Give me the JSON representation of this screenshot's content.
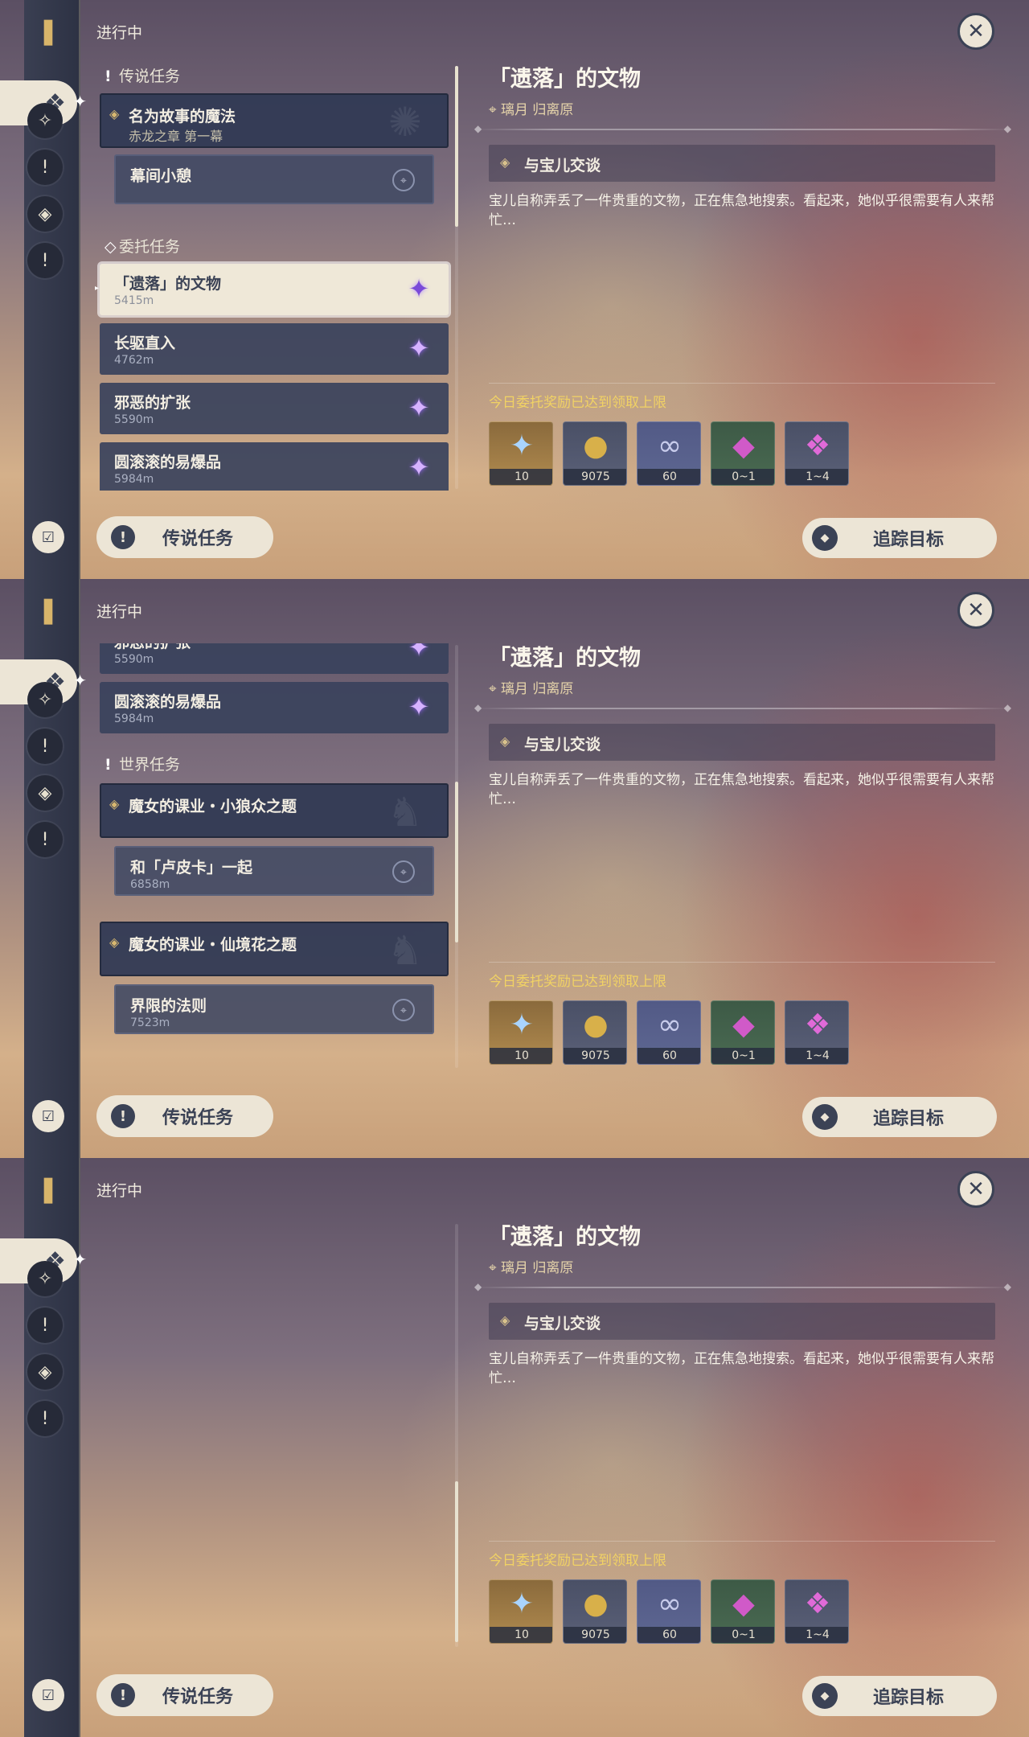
{
  "status_label": "进行中",
  "colors": {
    "accent": "#ece5d6",
    "reward_note": "#f1d264",
    "card": "#3a425c",
    "selected_card": "#efe8d8"
  },
  "icons": {
    "book": "book-icon",
    "close": "close-icon",
    "legend": "legend-quest-icon",
    "commission_star": "commission-star-icon",
    "location_pin": "location-pin-icon",
    "track": "track-icon"
  },
  "quests": {
    "legend_header": "传说任务",
    "legend_title": "名为故事的魔法",
    "legend_chapter": "赤龙之章 第一幕",
    "legend_sub": "幕间小憩",
    "commission_header": "委托任务",
    "c1_title": "「遗落」的文物",
    "c1_dist": "5415m",
    "c2_title": "长驱直入",
    "c2_dist": "4762m",
    "c3_title": "邪恶的扩张",
    "c3_dist": "5590m",
    "c4_title": "圆滚滚的易爆品",
    "c4_dist": "5984m",
    "world_header": "世界任务",
    "w1_title": "魔女的课业・小狼众之题",
    "w1_sub_title": "和「卢皮卡」一起",
    "w1_sub_dist": "6858m",
    "w2_title": "魔女的课业・仙境花之题",
    "w2_sub_title": "界限的法则",
    "w2_sub_dist": "7523m"
  },
  "detail": {
    "title": "「遗落」的文物",
    "location": "璃月 归离原",
    "objective": "与宝儿交谈",
    "description": "宝儿自称弄丢了一件贵重的文物，正在焦急地搜索。看起来，她似乎很需要有人来帮忙…",
    "reward_note": "今日委托奖励已达到领取上限",
    "rewards": [
      {
        "icon": "adventure-exp-icon",
        "qty": "10"
      },
      {
        "icon": "mora-icon",
        "qty": "9075"
      },
      {
        "icon": "companionship-exp-icon",
        "qty": "60"
      },
      {
        "icon": "crystal-chunk-icon",
        "qty": "0~1"
      },
      {
        "icon": "crystal-cluster-icon",
        "qty": "1~4"
      }
    ]
  },
  "buttons": {
    "legend": "传说任务",
    "track": "追踪目标"
  }
}
